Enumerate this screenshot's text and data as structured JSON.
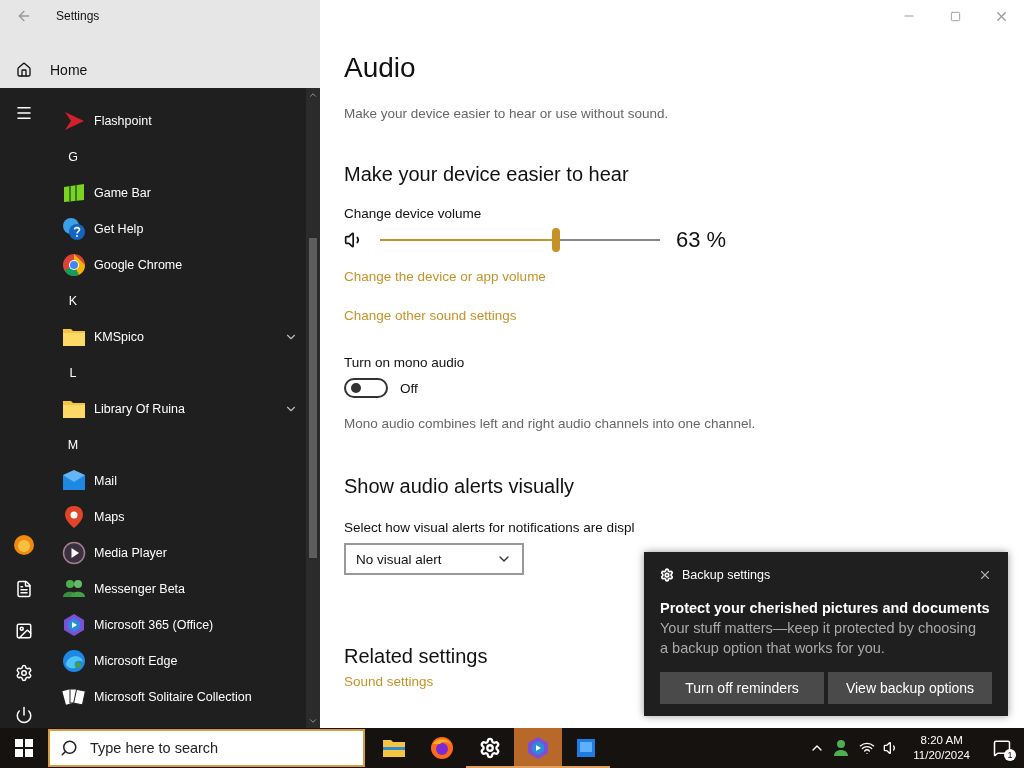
{
  "settings_header": {
    "title": "Settings",
    "home": "Home"
  },
  "start_menu": {
    "items": [
      {
        "kind": "app",
        "label": "Flashpoint"
      },
      {
        "kind": "letter",
        "label": "G"
      },
      {
        "kind": "app",
        "label": "Game Bar"
      },
      {
        "kind": "app",
        "label": "Get Help"
      },
      {
        "kind": "app",
        "label": "Google Chrome"
      },
      {
        "kind": "letter",
        "label": "K"
      },
      {
        "kind": "folder",
        "label": "KMSpico",
        "expanded": false
      },
      {
        "kind": "letter",
        "label": "L"
      },
      {
        "kind": "folder",
        "label": "Library Of Ruina",
        "expanded": false
      },
      {
        "kind": "letter",
        "label": "M"
      },
      {
        "kind": "app",
        "label": "Mail"
      },
      {
        "kind": "app",
        "label": "Maps"
      },
      {
        "kind": "app",
        "label": "Media Player"
      },
      {
        "kind": "app",
        "label": "Messenger Beta"
      },
      {
        "kind": "app",
        "label": "Microsoft 365 (Office)"
      },
      {
        "kind": "app",
        "label": "Microsoft Edge"
      },
      {
        "kind": "app",
        "label": "Microsoft Solitaire Collection"
      }
    ]
  },
  "page": {
    "title": "Audio",
    "subtitle": "Make your device easier to hear or use without sound.",
    "hear_section": {
      "heading": "Make your device easier to hear",
      "volume_label": "Change device volume",
      "volume": {
        "level": 0.63,
        "reading": "63 %"
      },
      "links": [
        "Change the device or app volume",
        "Change other sound settings"
      ],
      "mono": {
        "label": "Turn on mono audio",
        "on": false,
        "state_text": "Off",
        "description": "Mono audio combines left and right audio channels into one channel."
      }
    },
    "alerts_section": {
      "heading": "Show audio alerts visually",
      "label": "Select how visual alerts for notifications are displ",
      "dropdown_value": "No visual alert"
    },
    "related": {
      "heading": "Related settings",
      "links": [
        "Sound settings"
      ]
    }
  },
  "toast": {
    "app": "Backup settings",
    "heading": "Protect your cherished pictures and documents",
    "body": "Your stuff matters—keep it protected by choosing a backup option that works for you.",
    "buttons": [
      "Turn off reminders",
      "View backup options"
    ]
  },
  "taskbar": {
    "search_placeholder": "Type here to search",
    "apps": [
      {
        "selected": false,
        "running": false
      },
      {
        "selected": false,
        "running": false
      },
      {
        "selected": false,
        "running": true
      },
      {
        "selected": true,
        "running": true
      },
      {
        "selected": false,
        "running": true
      }
    ],
    "time": "8:20 AM",
    "date": "11/20/2024",
    "notification_count": "1"
  }
}
